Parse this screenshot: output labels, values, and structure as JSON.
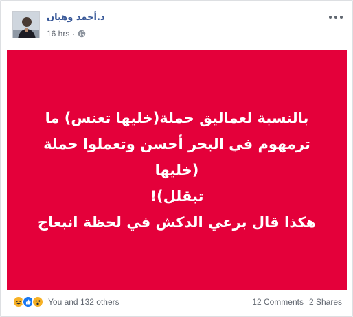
{
  "post": {
    "author": "د.أحمد وهبان",
    "time": "16 hrs",
    "dot": "·",
    "privacy_icon": "globe-icon",
    "more_icon": "more-options-icon",
    "background_color": "#e4003a",
    "text_lines": [
      "بالنسبة لعماليق حملة(خليها تعنس) ما",
      "ترمهوم في البحر أحسن وتعملوا حملة (خليها",
      "تبقلل)!",
      "هكذا قال برعي الدكش في لحظة انبعاج"
    ]
  },
  "footer": {
    "reaction_icons": [
      "laugh-reaction-icon",
      "like-reaction-icon",
      "wow-reaction-icon"
    ],
    "reactions_text": "You and 132 others",
    "comments": "12 Comments",
    "shares": "2 Shares"
  }
}
